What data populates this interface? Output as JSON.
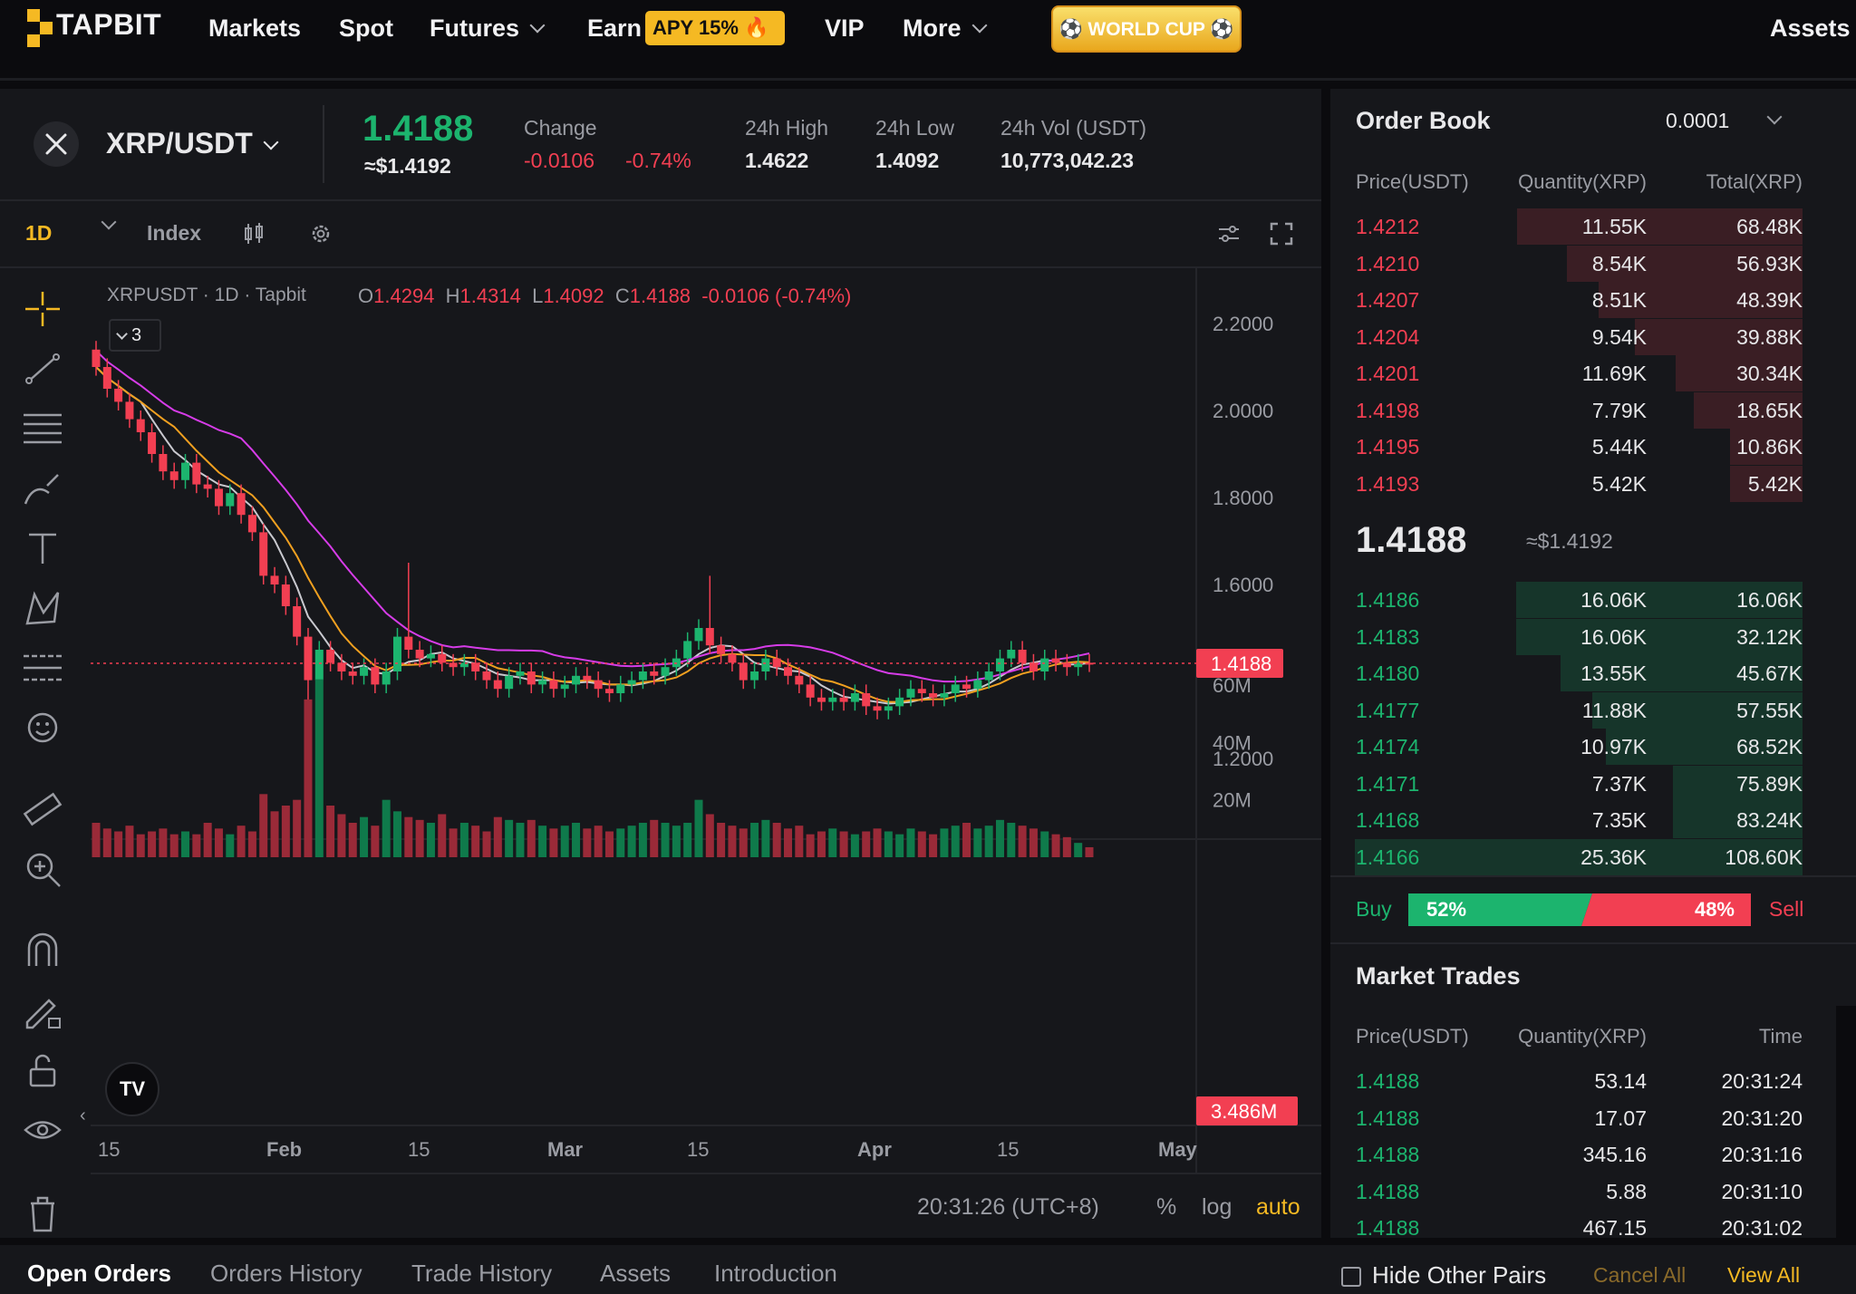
{
  "nav": {
    "logo": "TAPBIT",
    "items": [
      "Markets",
      "Spot",
      "Futures",
      "Earn",
      "VIP",
      "More"
    ],
    "apy_badge": "APY 15% 🔥",
    "world_cup": "⚽ WORLD CUP ⚽",
    "assets": "Assets"
  },
  "ticker": {
    "pair": "XRP/USDT",
    "last_price": "1.4188",
    "last_usd": "≈$1.4192",
    "change_label": "Change",
    "change_abs": "-0.0106",
    "change_pct": "-0.74%",
    "high_label": "24h High",
    "high": "1.4622",
    "low_label": "24h Low",
    "low": "1.4092",
    "vol_label": "24h Vol (USDT)",
    "vol": "10,773,042.23"
  },
  "chart_toolbar": {
    "interval": "1D",
    "index": "Index"
  },
  "chart_legend": {
    "symbol": "XRPUSDT",
    "interval": "1D",
    "source": "Tapbit",
    "o_label": "O",
    "o": "1.4294",
    "h_label": "H",
    "h": "1.4314",
    "l_label": "L",
    "l": "1.4092",
    "c_label": "C",
    "c": "1.4188",
    "chg": "-0.0106 (-0.74%)",
    "indicators_count": "3"
  },
  "chart_footer": {
    "time": "20:31:26 (UTC+8)",
    "pct": "%",
    "log": "log",
    "auto": "auto"
  },
  "chart_data": {
    "type": "candlestick",
    "price_axis_ticks": [
      "2.2000",
      "2.0000",
      "1.8000",
      "1.6000",
      "1.2000"
    ],
    "price_axis_values": [
      2.2,
      2.0,
      1.8,
      1.6,
      1.2
    ],
    "volume_axis_ticks": [
      "60M",
      "40M",
      "20M"
    ],
    "volume_axis_values": [
      60,
      40,
      20
    ],
    "x_ticks": [
      "15",
      "Feb",
      "15",
      "Mar",
      "15",
      "Apr",
      "15",
      "May"
    ],
    "last_price_tag": "1.4188",
    "last_volume_tag": "3.486M",
    "closes": [
      2.1,
      2.05,
      2.02,
      1.98,
      1.95,
      1.9,
      1.86,
      1.84,
      1.88,
      1.83,
      1.82,
      1.78,
      1.81,
      1.76,
      1.72,
      1.62,
      1.6,
      1.55,
      1.48,
      1.38,
      1.45,
      1.42,
      1.4,
      1.39,
      1.41,
      1.37,
      1.4,
      1.48,
      1.45,
      1.43,
      1.44,
      1.42,
      1.41,
      1.42,
      1.4,
      1.38,
      1.36,
      1.39,
      1.4,
      1.37,
      1.38,
      1.36,
      1.37,
      1.39,
      1.38,
      1.36,
      1.35,
      1.37,
      1.38,
      1.4,
      1.39,
      1.41,
      1.43,
      1.47,
      1.5,
      1.46,
      1.44,
      1.42,
      1.38,
      1.4,
      1.43,
      1.41,
      1.39,
      1.37,
      1.34,
      1.33,
      1.34,
      1.33,
      1.35,
      1.32,
      1.31,
      1.32,
      1.34,
      1.36,
      1.35,
      1.34,
      1.35,
      1.37,
      1.36,
      1.38,
      1.4,
      1.43,
      1.45,
      1.42,
      1.4,
      1.43,
      1.42,
      1.41,
      1.42,
      1.4188
    ],
    "volumes_m": [
      12,
      10,
      9,
      11,
      8,
      9,
      10,
      8,
      9,
      8,
      12,
      10,
      8,
      11,
      9,
      22,
      16,
      18,
      20,
      55,
      62,
      18,
      15,
      12,
      14,
      11,
      20,
      16,
      14,
      13,
      12,
      15,
      10,
      12,
      11,
      9,
      14,
      13,
      12,
      13,
      11,
      10,
      11,
      12,
      10,
      11,
      9,
      10,
      11,
      12,
      13,
      12,
      11,
      12,
      20,
      15,
      12,
      11,
      10,
      12,
      13,
      12,
      10,
      11,
      8,
      9,
      10,
      9,
      8,
      9,
      10,
      9,
      8,
      10,
      9,
      8,
      10,
      11,
      12,
      10,
      11,
      13,
      12,
      11,
      10,
      9,
      8,
      7,
      5,
      3.486
    ]
  },
  "order_book": {
    "title": "Order Book",
    "precision": "0.0001",
    "headers": [
      "Price(USDT)",
      "Quantity(XRP)",
      "Total(XRP)"
    ],
    "asks": [
      {
        "price": "1.4212",
        "qty": "11.55K",
        "total": "68.48K",
        "depth": 0.63
      },
      {
        "price": "1.4210",
        "qty": "8.54K",
        "total": "56.93K",
        "depth": 0.52
      },
      {
        "price": "1.4207",
        "qty": "8.51K",
        "total": "48.39K",
        "depth": 0.45
      },
      {
        "price": "1.4204",
        "qty": "9.54K",
        "total": "39.88K",
        "depth": 0.37
      },
      {
        "price": "1.4201",
        "qty": "11.69K",
        "total": "30.34K",
        "depth": 0.28
      },
      {
        "price": "1.4198",
        "qty": "7.79K",
        "total": "18.65K",
        "depth": 0.24
      },
      {
        "price": "1.4195",
        "qty": "5.44K",
        "total": "10.86K",
        "depth": 0.16
      },
      {
        "price": "1.4193",
        "qty": "5.42K",
        "total": "5.42K",
        "depth": 0.16
      }
    ],
    "mid_price": "1.4188",
    "mid_usd": "≈$1.4192",
    "bids": [
      {
        "price": "1.4186",
        "qty": "16.06K",
        "total": "16.06K",
        "depth": 0.64
      },
      {
        "price": "1.4183",
        "qty": "16.06K",
        "total": "32.12K",
        "depth": 0.64
      },
      {
        "price": "1.4180",
        "qty": "13.55K",
        "total": "45.67K",
        "depth": 0.54
      },
      {
        "price": "1.4177",
        "qty": "11.88K",
        "total": "57.55K",
        "depth": 0.47
      },
      {
        "price": "1.4174",
        "qty": "10.97K",
        "total": "68.52K",
        "depth": 0.44
      },
      {
        "price": "1.4171",
        "qty": "7.37K",
        "total": "75.89K",
        "depth": 0.29
      },
      {
        "price": "1.4168",
        "qty": "7.35K",
        "total": "83.24K",
        "depth": 0.29
      },
      {
        "price": "1.4166",
        "qty": "25.36K",
        "total": "108.60K",
        "depth": 1.0
      }
    ],
    "buy_label": "Buy",
    "buy_pct": "52%",
    "sell_pct": "48%",
    "sell_label": "Sell",
    "buy_ratio": 0.52
  },
  "market_trades": {
    "title": "Market Trades",
    "headers": [
      "Price(USDT)",
      "Quantity(XRP)",
      "Time"
    ],
    "rows": [
      {
        "price": "1.4188",
        "qty": "53.14",
        "time": "20:31:24"
      },
      {
        "price": "1.4188",
        "qty": "17.07",
        "time": "20:31:20"
      },
      {
        "price": "1.4188",
        "qty": "345.16",
        "time": "20:31:16"
      },
      {
        "price": "1.4188",
        "qty": "5.88",
        "time": "20:31:10"
      },
      {
        "price": "1.4188",
        "qty": "467.15",
        "time": "20:31:02"
      }
    ]
  },
  "bottom_tabs": {
    "tabs": [
      "Open Orders",
      "Orders History",
      "Trade History",
      "Assets",
      "Introduction"
    ],
    "hide_other_pairs": "Hide Other Pairs",
    "cancel_all": "Cancel All",
    "view_all": "View All"
  },
  "colors": {
    "green": "#1cb46e",
    "red": "#f23f52",
    "accent": "#f5b923"
  }
}
